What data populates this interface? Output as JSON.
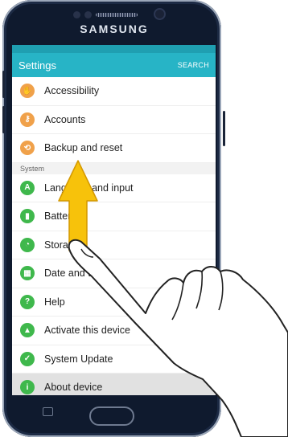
{
  "device": {
    "brand": "SAMSUNG"
  },
  "appbar": {
    "title": "Settings",
    "search": "SEARCH"
  },
  "items_top": [
    {
      "label": "Accessibility",
      "icon": "hand-icon",
      "color": "#f0a14a"
    },
    {
      "label": "Accounts",
      "icon": "key-icon",
      "color": "#f0a14a"
    },
    {
      "label": "Backup and reset",
      "icon": "backup-icon",
      "color": "#f0a14a"
    }
  ],
  "section": {
    "label": "System"
  },
  "items_system": [
    {
      "label": "Language and input",
      "icon": "language-icon",
      "color": "#3fb84c"
    },
    {
      "label": "Battery",
      "icon": "battery-icon",
      "color": "#3fb84c"
    },
    {
      "label": "Storage",
      "icon": "storage-icon",
      "color": "#3fb84c"
    },
    {
      "label": "Date and time",
      "icon": "date-time-icon",
      "color": "#3fb84c"
    },
    {
      "label": "Help",
      "icon": "help-icon",
      "color": "#3fb84c"
    },
    {
      "label": "Activate this device",
      "icon": "rocket-icon",
      "color": "#3fb84c"
    },
    {
      "label": "System Update",
      "icon": "check-icon",
      "color": "#3fb84c"
    },
    {
      "label": "About device",
      "icon": "info-icon",
      "color": "#3fb84c"
    }
  ],
  "gesture": {
    "type": "swipe-up",
    "arrow_color": "#f7c20b"
  }
}
